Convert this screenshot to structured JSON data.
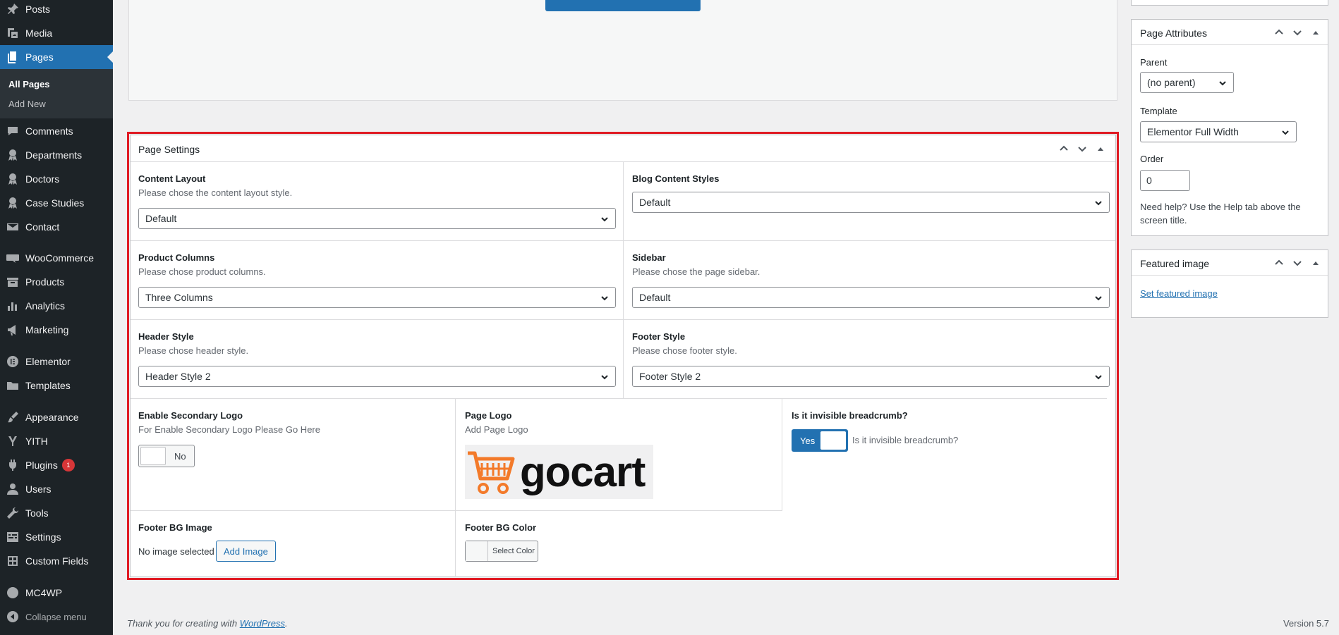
{
  "sidebar": {
    "items": [
      {
        "label": "Posts",
        "icon": "pin-icon"
      },
      {
        "label": "Media",
        "icon": "media-icon"
      },
      {
        "label": "Pages",
        "icon": "pages-icon"
      },
      {
        "label": "Comments",
        "icon": "comment-icon"
      },
      {
        "label": "Departments",
        "icon": "award-icon"
      },
      {
        "label": "Doctors",
        "icon": "award-icon"
      },
      {
        "label": "Case Studies",
        "icon": "award-icon"
      },
      {
        "label": "Contact",
        "icon": "mail-icon"
      },
      {
        "label": "WooCommerce",
        "icon": "woo-icon"
      },
      {
        "label": "Products",
        "icon": "archive-icon"
      },
      {
        "label": "Analytics",
        "icon": "chart-icon"
      },
      {
        "label": "Marketing",
        "icon": "megaphone-icon"
      },
      {
        "label": "Elementor",
        "icon": "elementor-icon"
      },
      {
        "label": "Templates",
        "icon": "folder-icon"
      },
      {
        "label": "Appearance",
        "icon": "brush-icon"
      },
      {
        "label": "YITH",
        "icon": "yith-icon"
      },
      {
        "label": "Plugins",
        "icon": "plugin-icon",
        "badge": "1"
      },
      {
        "label": "Users",
        "icon": "user-icon"
      },
      {
        "label": "Tools",
        "icon": "wrench-icon"
      },
      {
        "label": "Settings",
        "icon": "settings-icon"
      },
      {
        "label": "Custom Fields",
        "icon": "grid-icon"
      },
      {
        "label": "MC4WP",
        "icon": "mc4wp-icon"
      },
      {
        "label": "Collapse menu",
        "icon": "collapse-icon"
      }
    ],
    "submenu": [
      "All Pages",
      "Add New"
    ]
  },
  "page_settings": {
    "title": "Page Settings",
    "content_layout": {
      "label": "Content Layout",
      "desc": "Please chose the content layout style.",
      "value": "Default"
    },
    "blog_styles": {
      "label": "Blog Content Styles",
      "value": "Default"
    },
    "product_columns": {
      "label": "Product Columns",
      "desc": "Please chose product columns.",
      "value": "Three Columns"
    },
    "sidebar": {
      "label": "Sidebar",
      "desc": "Please chose the page sidebar.",
      "value": "Default"
    },
    "header_style": {
      "label": "Header Style",
      "desc": "Please chose header style.",
      "value": "Header Style 2"
    },
    "footer_style": {
      "label": "Footer Style",
      "desc": "Please chose footer style.",
      "value": "Footer Style 2"
    },
    "secondary_logo": {
      "label": "Enable Secondary Logo",
      "desc": "For Enable Secondary Logo Please Go Here",
      "toggle": "No"
    },
    "page_logo": {
      "label": "Page Logo",
      "desc": "Add Page Logo",
      "logo_text": "gocart"
    },
    "breadcrumb": {
      "label": "Is it invisible breadcrumb?",
      "toggle": "Yes",
      "desc": "Is it invisible breadcrumb?"
    },
    "footer_bg_image": {
      "label": "Footer BG Image",
      "status": "No image selected",
      "button": "Add Image"
    },
    "footer_bg_color": {
      "label": "Footer BG Color",
      "button": "Select Color"
    }
  },
  "page_attributes": {
    "title": "Page Attributes",
    "parent_label": "Parent",
    "parent_value": "(no parent)",
    "template_label": "Template",
    "template_value": "Elementor Full Width",
    "order_label": "Order",
    "order_value": "0",
    "help": "Need help? Use the Help tab above the screen title."
  },
  "featured_image": {
    "title": "Featured image",
    "link": "Set featured image"
  },
  "footer": {
    "thanks_prefix": "Thank you for creating with ",
    "wp_link": "WordPress",
    "thanks_suffix": ".",
    "version": "Version 5.7"
  },
  "colors": {
    "accent": "#2271b1",
    "highlight": "#e01b24",
    "sidebar_bg": "#1d2327",
    "logo_orange": "#f37a2a"
  }
}
